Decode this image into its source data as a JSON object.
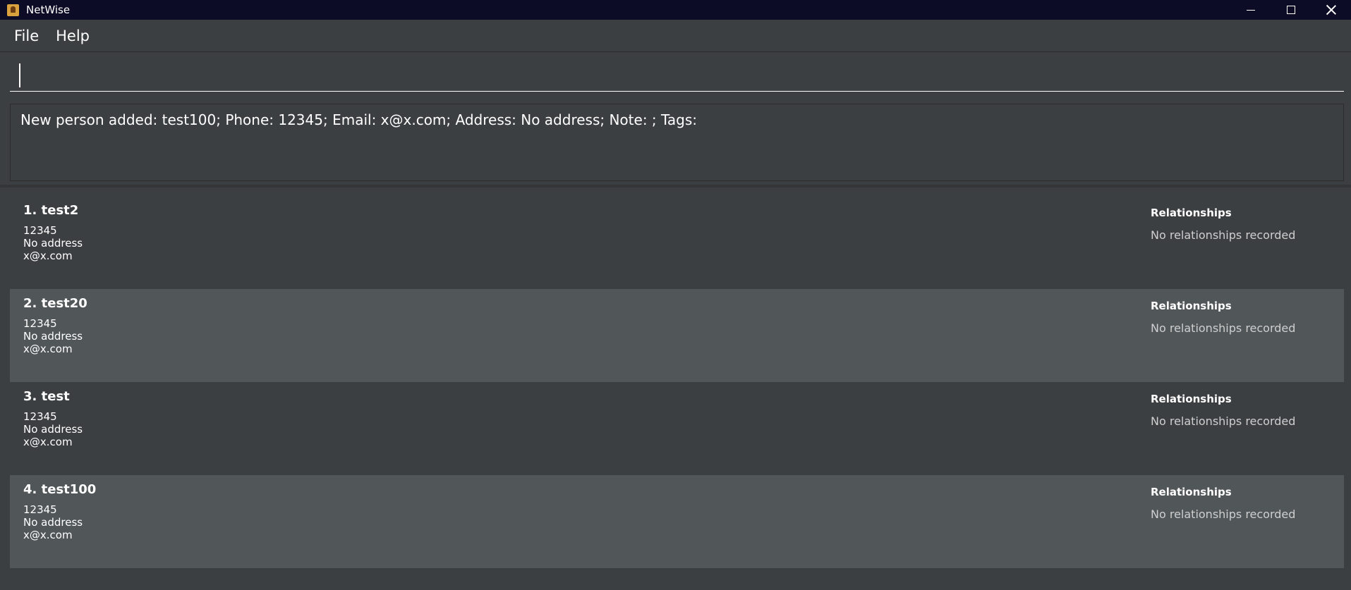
{
  "window": {
    "title": "NetWise",
    "controls": [
      "minimize-icon",
      "maximize-icon",
      "close-icon"
    ]
  },
  "menu": {
    "items": [
      "File",
      "Help"
    ]
  },
  "command_box": {
    "value": "",
    "placeholder": ""
  },
  "result_display": {
    "text": "New person added: test100; Phone: 12345; Email: x@x.com; Address: No address; Note: ; Tags:"
  },
  "person_list": [
    {
      "name": "1. test2",
      "phone": "12345",
      "address": "No address",
      "email": "x@x.com",
      "relationships_title": "Relationships",
      "relationships_text": "No relationships recorded"
    },
    {
      "name": "2. test20",
      "phone": "12345",
      "address": "No address",
      "email": "x@x.com",
      "relationships_title": "Relationships",
      "relationships_text": "No relationships recorded"
    },
    {
      "name": "3. test",
      "phone": "12345",
      "address": "No address",
      "email": "x@x.com",
      "relationships_title": "Relationships",
      "relationships_text": "No relationships recorded"
    },
    {
      "name": "4. test100",
      "phone": "12345",
      "address": "No address",
      "email": "x@x.com",
      "relationships_title": "Relationships",
      "relationships_text": "No relationships recorded"
    }
  ],
  "colors": {
    "title_bar": "#0c0c26",
    "background": "#3c3f41",
    "card_alt": "#515658",
    "text": "#ffffff"
  }
}
